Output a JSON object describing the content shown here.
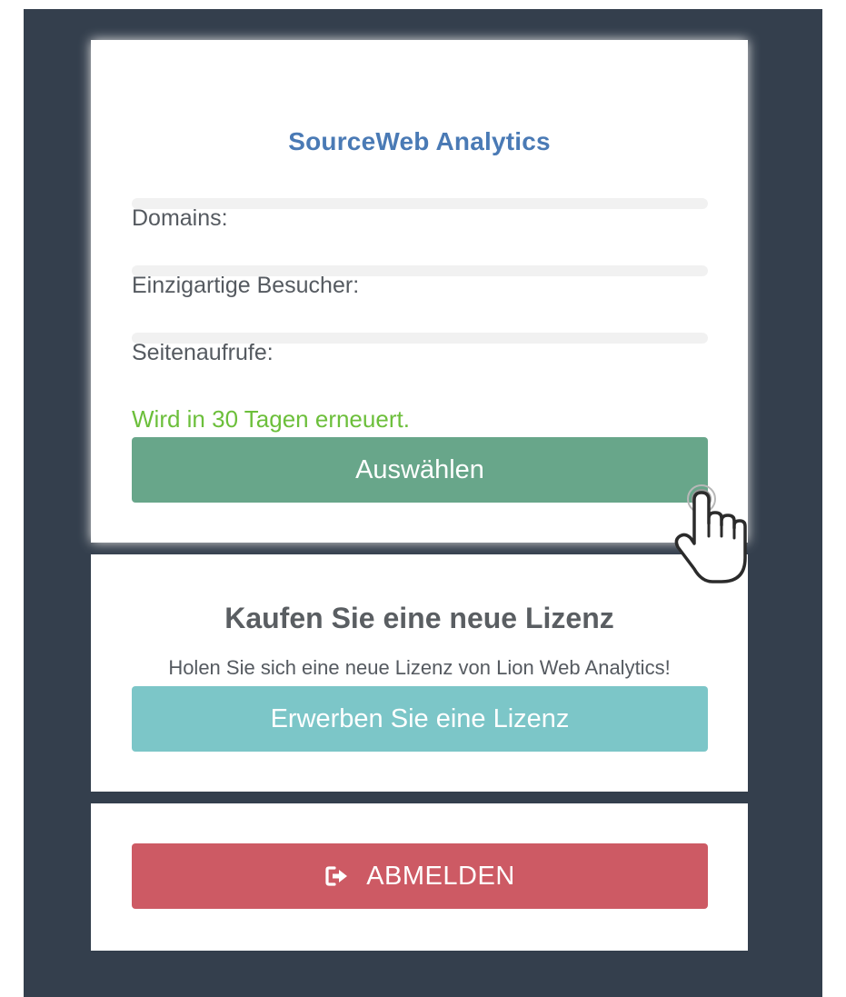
{
  "license_card": {
    "title": "SourceWeb Analytics",
    "stats": [
      {
        "label": "Domains:"
      },
      {
        "label": "Einzigartige Besucher:"
      },
      {
        "label": "Seitenaufrufe:"
      }
    ],
    "renew_text": "Wird in 30 Tagen erneuert.",
    "select_button": "Auswählen"
  },
  "buy_card": {
    "title": "Kaufen Sie eine neue Lizenz",
    "subtitle": "Holen Sie sich eine neue Lizenz von Lion Web Analytics!",
    "buy_button": "Erwerben Sie eine Lizenz"
  },
  "logout_card": {
    "logout_button": "ABMELDEN",
    "logout_icon": "sign-out-icon"
  },
  "cursor": {
    "icon": "hand-pointer-icon"
  },
  "colors": {
    "background": "#343f4d",
    "title_blue": "#4a7ab5",
    "renew_green": "#6cbf3b",
    "select_button": "#68a68a",
    "buy_button": "#7cc6c8",
    "logout_button": "#cd5a64"
  }
}
